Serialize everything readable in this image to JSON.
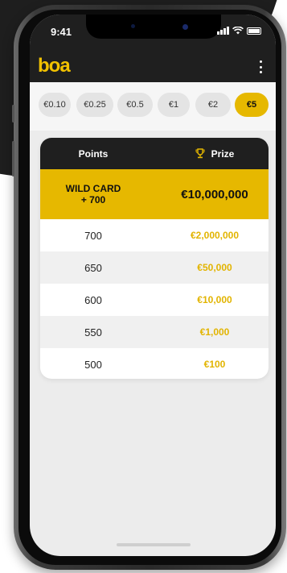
{
  "status_bar": {
    "time": "9:41"
  },
  "app": {
    "logo": "boa"
  },
  "icons": {
    "menu": "kebab-menu-icon",
    "trophy": "trophy-icon",
    "signal": "signal-icon",
    "wifi": "wifi-icon",
    "battery": "battery-icon"
  },
  "colors": {
    "accent": "#e6b800",
    "prize_text": "#e2b400",
    "header_bg": "#1f1f1f"
  },
  "stakes": {
    "options": [
      "€0.10",
      "€0.25",
      "€0.5",
      "€1",
      "€2",
      "€5"
    ],
    "selected": "€5"
  },
  "table": {
    "headers": {
      "points": "Points",
      "prize": "Prize"
    },
    "top_row": {
      "points_line1": "WILD CARD",
      "points_line2": "+ 700",
      "prize": "€10,000,000"
    },
    "rows": [
      {
        "points": "700",
        "prize": "€2,000,000"
      },
      {
        "points": "650",
        "prize": "€50,000"
      },
      {
        "points": "600",
        "prize": "€10,000"
      },
      {
        "points": "550",
        "prize": "€1,000"
      },
      {
        "points": "500",
        "prize": "€100"
      }
    ]
  }
}
